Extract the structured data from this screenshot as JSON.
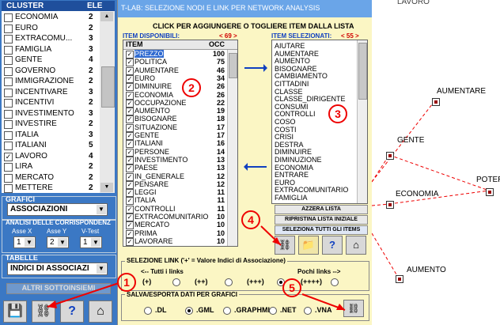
{
  "cluster_panel": {
    "col_cluster": "CLUSTER",
    "col_ele": "ELE",
    "items": [
      {
        "name": "ECONOMIA",
        "count": "2",
        "checked": false
      },
      {
        "name": "EURO",
        "count": "2",
        "checked": false
      },
      {
        "name": "EXTRACOMU...",
        "count": "3",
        "checked": false
      },
      {
        "name": "FAMIGLIA",
        "count": "3",
        "checked": false
      },
      {
        "name": "GENTE",
        "count": "4",
        "checked": false
      },
      {
        "name": "GOVERNO",
        "count": "2",
        "checked": false
      },
      {
        "name": "IMMIGRAZIONE",
        "count": "2",
        "checked": false
      },
      {
        "name": "INCENTIVARE",
        "count": "3",
        "checked": false
      },
      {
        "name": "INCENTIVI",
        "count": "2",
        "checked": false
      },
      {
        "name": "INVESTIMENTO",
        "count": "3",
        "checked": false
      },
      {
        "name": "INVESTIRE",
        "count": "2",
        "checked": false
      },
      {
        "name": "ITALIA",
        "count": "3",
        "checked": false
      },
      {
        "name": "ITALIANI",
        "count": "5",
        "checked": false
      },
      {
        "name": "LAVORO",
        "count": "4",
        "checked": true
      },
      {
        "name": "LIRA",
        "count": "2",
        "checked": false
      },
      {
        "name": "MERCATO",
        "count": "2",
        "checked": false
      },
      {
        "name": "METTERE",
        "count": "2",
        "checked": false
      }
    ],
    "grafici_title": "GRAFICI",
    "grafici_value": "ASSOCIAZIONI",
    "analisi_title": "ANALISI DELLE CORRISPONDENZ",
    "asse_x_label": "Asse X",
    "asse_y_label": "Asse Y",
    "vtest_label": "V-Test",
    "asse_x_value": "1",
    "asse_y_value": "2",
    "vtest_value": "1",
    "tabelle_title": "TABELLE",
    "tabelle_value": "INDICI DI ASSOCIAZI",
    "altri_button": "ALTRI SOTTOINSIEMI"
  },
  "dialog": {
    "title": "T-LAB: SELEZIONE NODI E LINK PER NETWORK ANALYSIS",
    "instruction": "CLICK PER AGGIUNGERE O TOGLIERE ITEM DALLA LISTA",
    "available_label": "ITEM DISPONIBILI:",
    "available_count": "< 69 >",
    "selected_label": "ITEM SELEZIONATI:",
    "selected_count": "< 55 >",
    "col_item": "ITEM",
    "col_occ": "OCC",
    "available_items": [
      {
        "name": "PREZZO",
        "occ": "100",
        "selected": true
      },
      {
        "name": "POLITICA",
        "occ": "75"
      },
      {
        "name": "AUMENTARE",
        "occ": "46"
      },
      {
        "name": "EURO",
        "occ": "34"
      },
      {
        "name": "DIMINUIRE",
        "occ": "26"
      },
      {
        "name": "ECONOMIA",
        "occ": "26"
      },
      {
        "name": "OCCUPAZIONE",
        "occ": "22"
      },
      {
        "name": "AUMENTO",
        "occ": "19"
      },
      {
        "name": "BISOGNARE",
        "occ": "18"
      },
      {
        "name": "SITUAZIONE",
        "occ": "17"
      },
      {
        "name": "GENTE",
        "occ": "17"
      },
      {
        "name": "ITALIANI",
        "occ": "16"
      },
      {
        "name": "PERSONE",
        "occ": "14"
      },
      {
        "name": "INVESTIMENTO",
        "occ": "13"
      },
      {
        "name": "PAESE",
        "occ": "13"
      },
      {
        "name": "IN_GENERALE",
        "occ": "12"
      },
      {
        "name": "PENSARE",
        "occ": "12"
      },
      {
        "name": "LEGGI",
        "occ": "11"
      },
      {
        "name": "ITALIA",
        "occ": "11"
      },
      {
        "name": "CONTROLLI",
        "occ": "11"
      },
      {
        "name": "EXTRACOMUNITARIO",
        "occ": "10"
      },
      {
        "name": "MERCATO",
        "occ": "10"
      },
      {
        "name": "PRIMA",
        "occ": "10"
      },
      {
        "name": "LAVORARE",
        "occ": "10"
      }
    ],
    "selected_items": [
      "AIUTARE",
      "AUMENTARE",
      "AUMENTO",
      "BISOGNARE",
      "CAMBIAMENTO",
      "CITTADINI",
      "CLASSE",
      "CLASSE_DIRIGENTE",
      "CONSUMI",
      "CONTROLLI",
      "COSO",
      "COSTI",
      "CRISI",
      "DESTRA",
      "DIMINUIRE",
      "DIMINUZIONE",
      "ECONOMIA",
      "ENTRARE",
      "EURO",
      "EXTRACOMUNITARIO",
      "FAMIGLIA"
    ],
    "btn_azzera": "AZZERA LISTA",
    "btn_ripristina": "RIPRISTINA LISTA INIZIALE",
    "btn_seleziona": "SELEZIONA TUTTI GLI ITEMS",
    "link_title": "SELEZIONE LINK ('+' = Valore Indici di Associazione)",
    "tutti_label": "<-- Tutti i links",
    "pochi_label": "Pochi links -->",
    "link_options": [
      "(+)",
      "(++)",
      "(+++)",
      "(++++)"
    ],
    "link_selected": "(+++)",
    "export_title": "SALVA/ESPORTA DATI PER GRAFICI",
    "export_options": [
      ".DL",
      ".GML",
      ".GRAPHML",
      ".NET",
      ".VNA"
    ],
    "export_selected": ".GML",
    "callouts": [
      "1",
      "2",
      "3",
      "4",
      "5"
    ]
  },
  "graph": {
    "nodes": [
      "AUMENTARE",
      "GENTE",
      "POTERE",
      "ECONOMIA",
      "AUMENTO"
    ]
  },
  "colors": {
    "accent_red": "#e00000",
    "title_blue": "#6aa5e8",
    "panel_blue": "#3b78c4",
    "dialog_bg": "#fbf6c4"
  }
}
